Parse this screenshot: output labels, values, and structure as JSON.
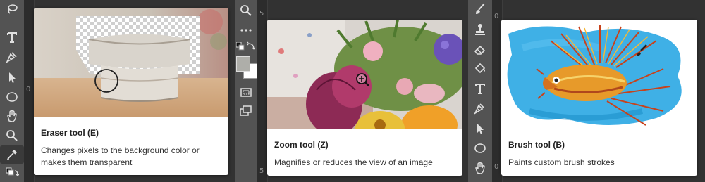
{
  "cards": {
    "eraser": {
      "title": "Eraser tool (E)",
      "description": "Changes pixels to the background color or makes them transparent"
    },
    "zoom": {
      "title": "Zoom tool (Z)",
      "description": "Magnifies or reduces the view of an image"
    },
    "brush": {
      "title": "Brush tool (B)",
      "description": "Paints custom brush strokes"
    }
  },
  "rulers": {
    "left_marker": "0",
    "middle_top_marker": "5",
    "middle_bottom_marker": "5",
    "right_top_marker": "0",
    "right_bottom_marker": "0"
  },
  "toolbars": {
    "left": [
      "lasso-icon",
      "type-tool-icon",
      "pen-tool-icon",
      "path-selection-icon",
      "ellipse-tool-icon",
      "hand-tool-icon",
      "zoom-tool-icon",
      "eyedropper-icon",
      "swap-colors-icon"
    ],
    "middle": [
      "zoom-tool-icon",
      "more-tools-icon",
      "default-colors-icon",
      "swap-colors-icon",
      "color-swatches",
      "quick-mask-icon",
      "screen-mode-icon"
    ],
    "right": [
      "brush-tool-icon",
      "clone-stamp-icon",
      "eraser-tool-icon",
      "paint-bucket-icon",
      "type-tool-icon",
      "pen-tool-icon",
      "path-selection-icon",
      "ellipse-tool-icon",
      "hand-tool-icon"
    ]
  },
  "colors": {
    "ui_background": "#323232",
    "toolbar": "#535353",
    "foreground_swatch": "#aeaea9",
    "background_swatch": "#ffffff",
    "card": "#ffffff"
  }
}
